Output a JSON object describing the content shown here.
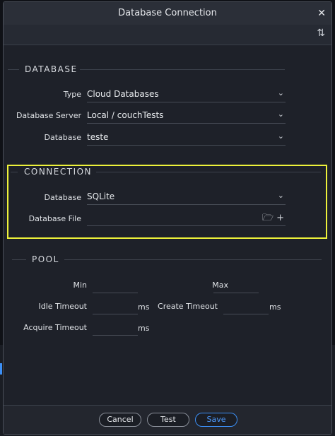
{
  "window": {
    "title": "Database Connection"
  },
  "toolbar": {
    "sort_icon": "sort-up-down-icon"
  },
  "database": {
    "section_title": "DATABASE",
    "type_label": "Type",
    "type_value": "Cloud Databases",
    "server_label": "Database Server",
    "server_value": "Local / couchTests",
    "db_label": "Database",
    "db_value": "teste"
  },
  "connection": {
    "section_title": "CONNECTION",
    "db_label": "Database",
    "db_value": "SQLite",
    "file_label": "Database File",
    "file_value": ""
  },
  "pool": {
    "section_title": "POOL",
    "min_label": "Min",
    "max_label": "Max",
    "idle_label": "Idle Timeout",
    "create_label": "Create Timeout",
    "acquire_label": "Acquire Timeout",
    "unit": "ms",
    "min_value": "",
    "max_value": "",
    "idle_value": "",
    "create_value": "",
    "acquire_value": ""
  },
  "footer": {
    "cancel": "Cancel",
    "test": "Test",
    "save": "Save"
  },
  "colors": {
    "accent": "#3c8ff5",
    "highlight": "#eef23a",
    "background": "#1e2129"
  }
}
